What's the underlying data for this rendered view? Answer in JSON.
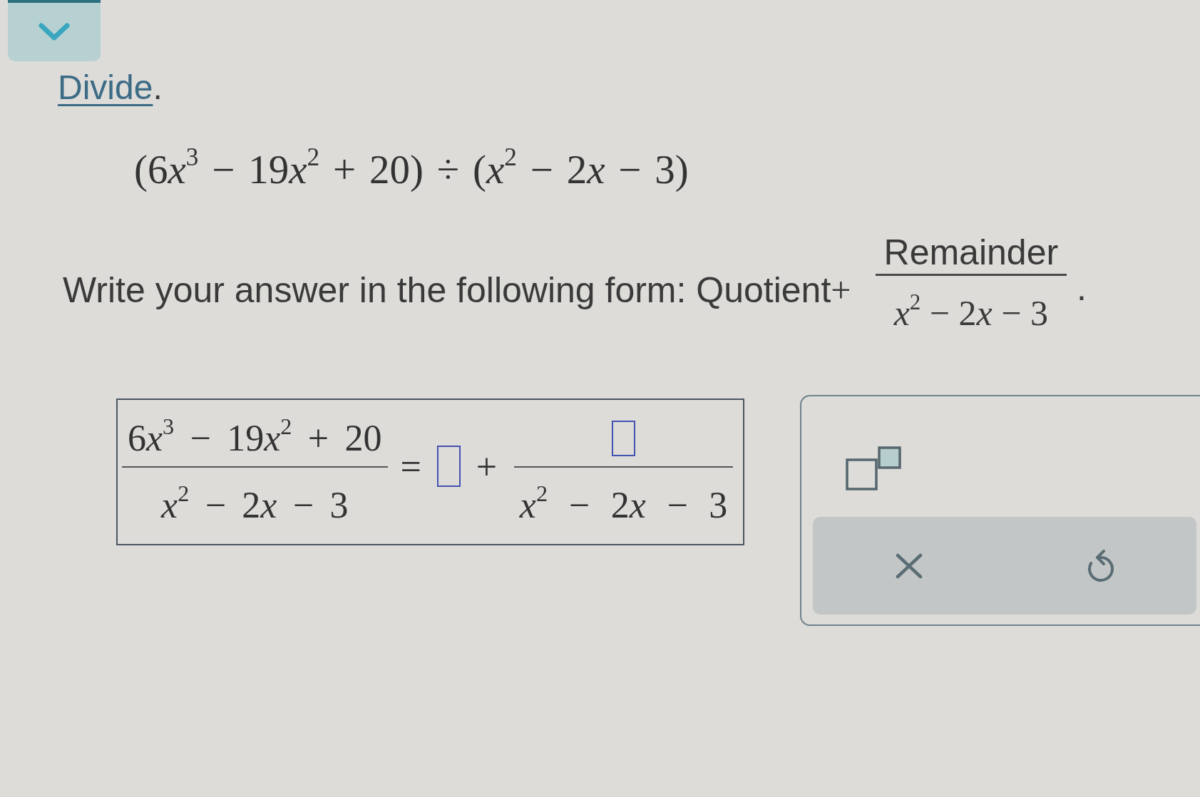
{
  "heading": {
    "link": "Divide",
    "after": "."
  },
  "problem": {
    "expression": "(6x$^{3}$ − 19x$^{2}$ + 20) ÷ (x$^{2}$ − 2x − 3)"
  },
  "form_prompt": {
    "text": "Write your answer in the following form: Quotient",
    "operator": "+",
    "fraction": {
      "numerator": "Remainder",
      "denominator": "x$^{2}$ − 2x − 3"
    },
    "end": "."
  },
  "answer": {
    "lhs": {
      "numerator": "6x$^{3}$ − 19x$^{2}$ + 20",
      "denominator": "x$^{2}$ − 2x − 3"
    },
    "relation": "=",
    "rhs": [
      {
        "kind": "field"
      },
      {
        "kind": "operator",
        "text": "+"
      },
      {
        "kind": "fraction",
        "numerator": {
          "kind": "field"
        },
        "denominator": "x$^{2}$ − 2x − 3"
      }
    ]
  }
}
